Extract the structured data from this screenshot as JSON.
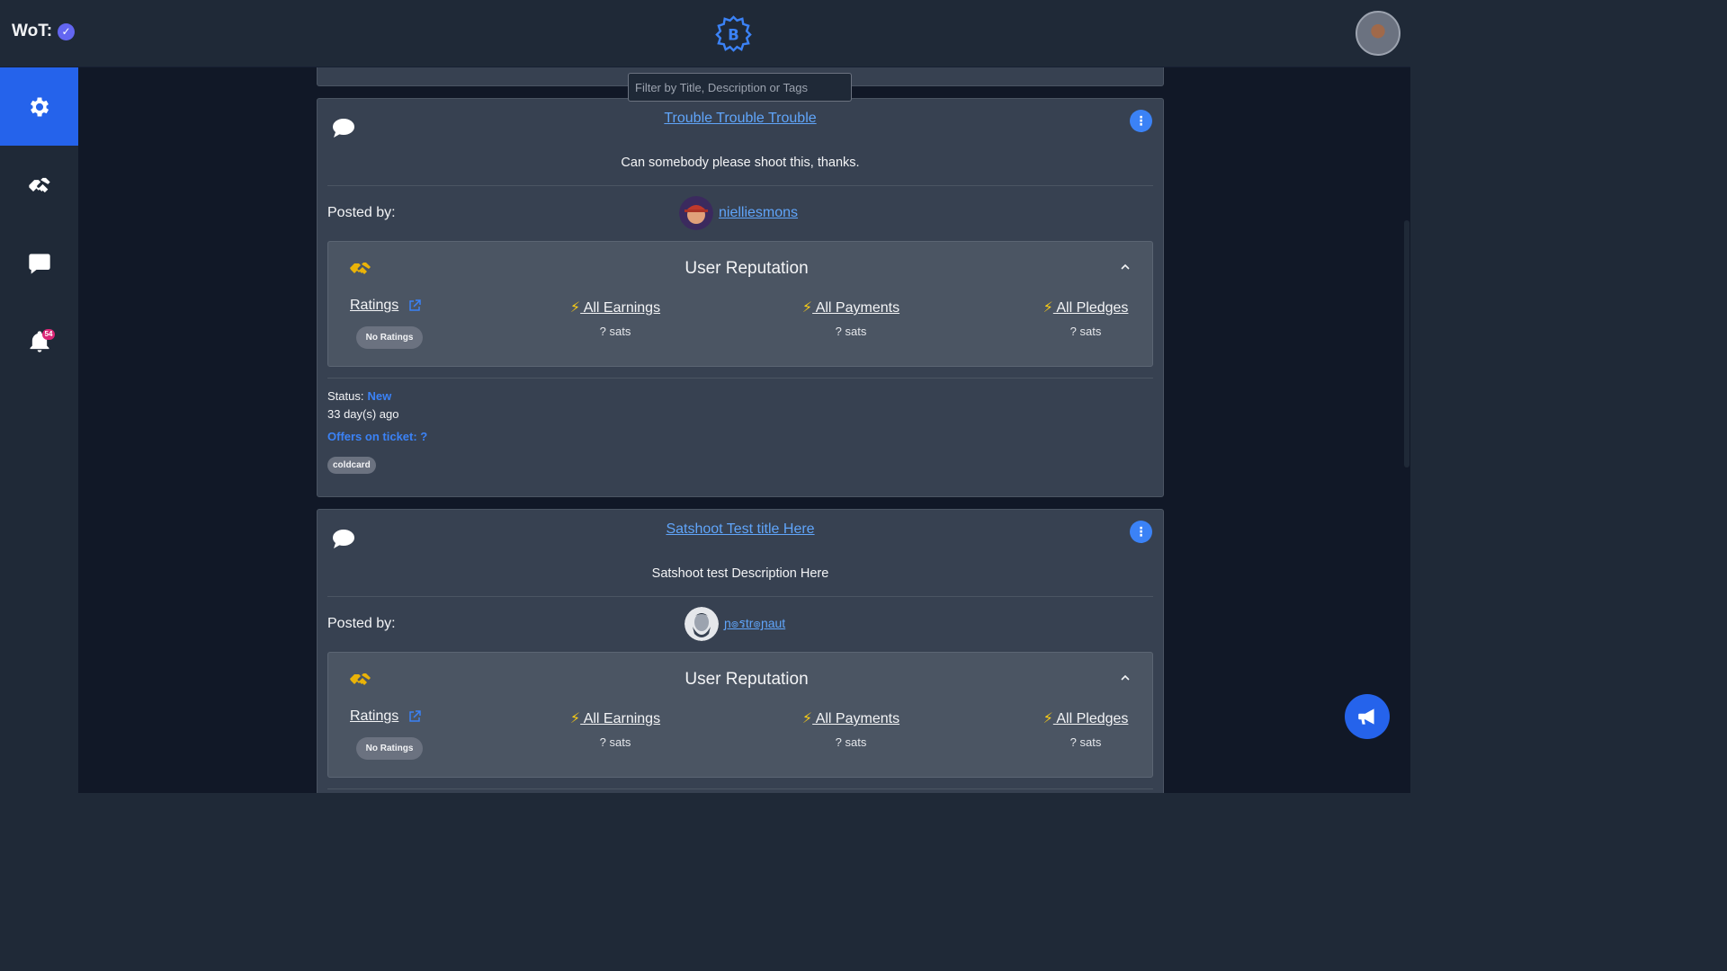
{
  "header": {
    "wot_label": "WoT:",
    "wot_check": "✓"
  },
  "sidebar": {
    "items": [
      {
        "name": "settings",
        "icon": "gear-icon",
        "active": true
      },
      {
        "name": "handshake",
        "icon": "handshake-icon",
        "active": false
      },
      {
        "name": "messages",
        "icon": "chat-icon",
        "active": false
      },
      {
        "name": "notifications",
        "icon": "bell-icon",
        "active": false,
        "badge": "54"
      }
    ]
  },
  "filter": {
    "placeholder": "Filter by Title, Description or Tags"
  },
  "tickets": [
    {
      "title": "Trouble Trouble Trouble",
      "menu": "⋮",
      "description": "Can somebody please shoot this, thanks.",
      "posted_label": "Posted by:",
      "poster_name": "nielliesmons",
      "reputation": {
        "title": "User Reputation",
        "ratings_label": "Ratings",
        "no_ratings": "No Ratings",
        "earnings_label": " All Earnings",
        "earnings_value": "? sats",
        "payments_label": " All Payments",
        "payments_value": "? sats",
        "pledges_label": " All Pledges",
        "pledges_value": "? sats"
      },
      "status_label": "Status:",
      "status_value": "New",
      "age": "33 day(s) ago",
      "offers": "Offers on ticket: ?",
      "tags": [
        "coldcard"
      ]
    },
    {
      "title": "Satshoot Test title Here",
      "menu": "⋮",
      "description": "Satshoot test Description Here",
      "posted_label": "Posted by:",
      "poster_name": "ɲ๏รtr๏ɲaut",
      "reputation": {
        "title": "User Reputation",
        "ratings_label": "Ratings",
        "no_ratings": "No Ratings",
        "earnings_label": " All Earnings",
        "earnings_value": "? sats",
        "payments_label": " All Payments",
        "payments_value": "? sats",
        "pledges_label": " All Pledges",
        "pledges_value": "? sats"
      }
    }
  ],
  "colors": {
    "accent": "#2563eb",
    "link": "#60a5fa",
    "bolt": "#facc15",
    "card_bg": "#374151",
    "page_bg": "#111827",
    "badge": "#db2777"
  },
  "fab": {
    "icon": "megaphone-icon"
  }
}
